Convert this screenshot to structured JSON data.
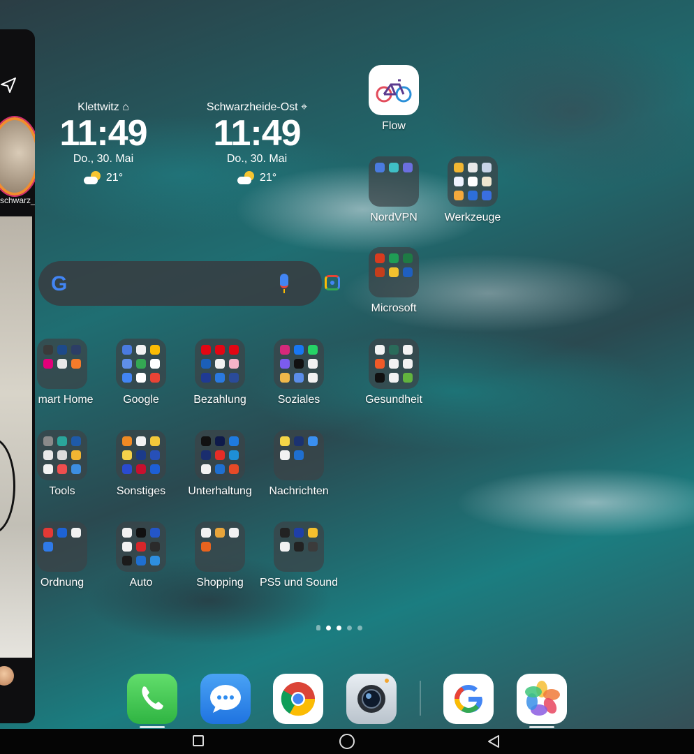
{
  "side_panel": {
    "username": "schwarz_"
  },
  "clocks": [
    {
      "city": "Klettwitz",
      "time": "11:49",
      "date": "Do., 30. Mai",
      "temp": "21°"
    },
    {
      "city": "Schwarzheide-Ost",
      "time": "11:49",
      "date": "Do., 30. Mai",
      "temp": "21°"
    }
  ],
  "search": {
    "logo": "G"
  },
  "apps": {
    "flow": "Flow"
  },
  "folders": {
    "nordvpn": "NordVPN",
    "werkzeuge": "Werkzeuge",
    "microsoft": "Microsoft",
    "smart_home": "mart Home",
    "google": "Google",
    "bezahlung": "Bezahlung",
    "soziales": "Soziales",
    "gesundheit": "Gesundheit",
    "tools": "Tools",
    "sonstiges": "Sonstiges",
    "unterhaltung": "Unterhaltung",
    "nachrichten": "Nachrichten",
    "ordnung": "Ordnung",
    "auto": "Auto",
    "shopping": "Shopping",
    "ps5": "PS5 und Sound"
  },
  "colors": {
    "accent": "#4285f4",
    "phone": "#3dc24f",
    "messages": "#2e8cf0"
  }
}
